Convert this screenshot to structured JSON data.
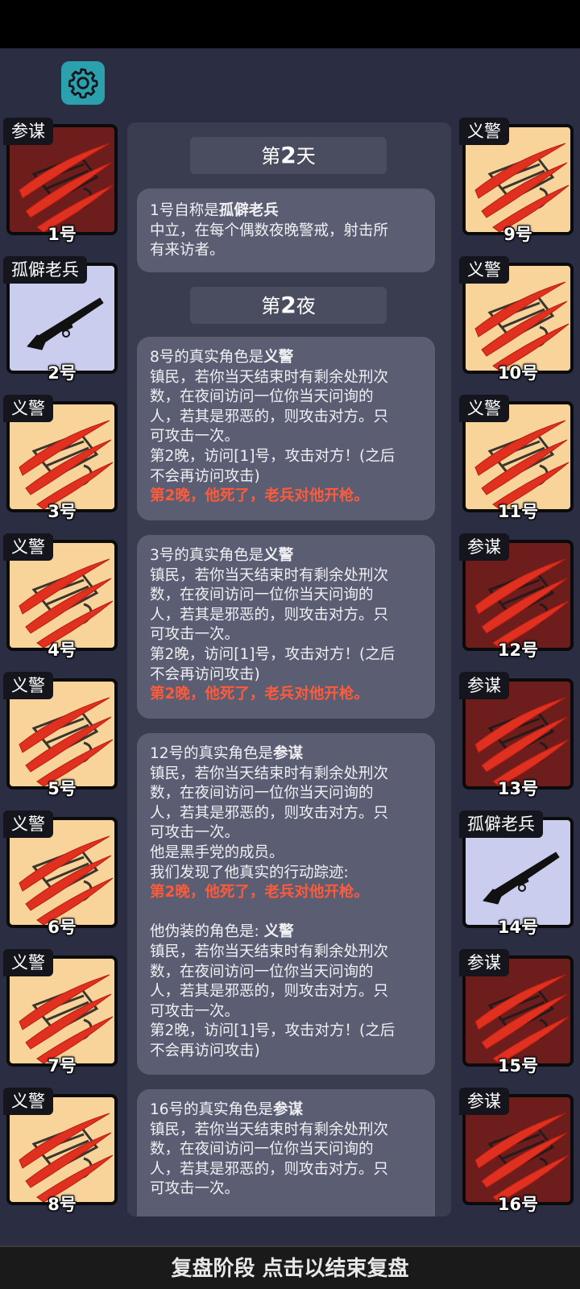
{
  "footer": {
    "label": "复盘阶段 点击以结束复盘"
  },
  "icons": {
    "settings": "gear-icon",
    "claw": "claw-mark-icon",
    "rifle": "rifle-icon"
  },
  "colors": {
    "yellow_card": "#f8d49b",
    "red_card": "#6e1d1d",
    "lavender_card": "#cbcdef",
    "accent": "#2aa1ad",
    "death_text": "#ff5a3a"
  },
  "left_players": [
    {
      "role": "参谋",
      "number": "1号",
      "style": "red",
      "art": "claw"
    },
    {
      "role": "孤僻老兵",
      "number": "2号",
      "style": "lav",
      "art": "rifle"
    },
    {
      "role": "义警",
      "number": "3号",
      "style": "yellow",
      "art": "claw"
    },
    {
      "role": "义警",
      "number": "4号",
      "style": "yellow",
      "art": "claw"
    },
    {
      "role": "义警",
      "number": "5号",
      "style": "yellow",
      "art": "claw"
    },
    {
      "role": "义警",
      "number": "6号",
      "style": "yellow",
      "art": "claw"
    },
    {
      "role": "义警",
      "number": "7号",
      "style": "yellow",
      "art": "claw"
    },
    {
      "role": "义警",
      "number": "8号",
      "style": "yellow",
      "art": "claw"
    }
  ],
  "right_players": [
    {
      "role": "义警",
      "number": "9号",
      "style": "yellow",
      "art": "claw"
    },
    {
      "role": "义警",
      "number": "10号",
      "style": "yellow",
      "art": "claw"
    },
    {
      "role": "义警",
      "number": "11号",
      "style": "yellow",
      "art": "claw"
    },
    {
      "role": "参谋",
      "number": "12号",
      "style": "red",
      "art": "claw"
    },
    {
      "role": "参谋",
      "number": "13号",
      "style": "red",
      "art": "claw"
    },
    {
      "role": "孤僻老兵",
      "number": "14号",
      "style": "lav",
      "art": "rifle"
    },
    {
      "role": "参谋",
      "number": "15号",
      "style": "red",
      "art": "claw"
    },
    {
      "role": "参谋",
      "number": "16号",
      "style": "red",
      "art": "claw"
    }
  ],
  "log": {
    "day_title": {
      "prefix": "第",
      "num": "2",
      "suffix": "天"
    },
    "night_title": {
      "prefix": "第",
      "num": "2",
      "suffix": "夜"
    },
    "day_entry": {
      "intro": "1号自称是",
      "role": "孤僻老兵",
      "lines": [
        "中立，在每个偶数夜晚警戒，射击所",
        "有来访者。"
      ]
    },
    "entries": [
      {
        "intro": "8号的真实角色是",
        "role": "义警",
        "lines": [
          "镇民，若你当天结束时有剩余处刑次",
          "数，在夜间访问一位你当天问询的",
          "人，若其是邪恶的，则攻击对方。只",
          "可攻击一次。",
          "第2晚，访问[1]号，攻击对方！(之后",
          "不会再访问攻击)"
        ],
        "death": "第2晚，他死了，老兵对他开枪。"
      },
      {
        "intro": "3号的真实角色是",
        "role": "义警",
        "lines": [
          "镇民，若你当天结束时有剩余处刑次",
          "数，在夜间访问一位你当天问询的",
          "人，若其是邪恶的，则攻击对方。只",
          "可攻击一次。",
          "第2晚，访问[1]号，攻击对方！(之后",
          "不会再访问攻击)"
        ],
        "death": "第2晚，他死了，老兵对他开枪。"
      },
      {
        "intro": "12号的真实角色是",
        "role": "参谋",
        "lines": [
          "镇民，若你当天结束时有剩余处刑次",
          "数，在夜间访问一位你当天问询的",
          "人，若其是邪恶的，则攻击对方。只",
          "可攻击一次。",
          "他是黑手党的成员。",
          "我们发现了他真实的行动踪迹:"
        ],
        "death": "第2晚，他死了，老兵对他开枪。",
        "disguise_intro": "他伪装的角色是: ",
        "disguise_role": "义警",
        "disguise_lines": [
          "镇民，若你当天结束时有剩余处刑次",
          "数，在夜间访问一位你当天问询的",
          "人，若其是邪恶的，则攻击对方。只",
          "可攻击一次。",
          "第2晚，访问[1]号，攻击对方！(之后",
          "不会再访问攻击)"
        ]
      },
      {
        "intro": "16号的真实角色是",
        "role": "参谋",
        "lines": [
          "镇民，若你当天结束时有剩余处刑次",
          "数，在夜间访问一位你当天问询的",
          "人，若其是邪恶的，则攻击对方。只",
          "可攻击一次。"
        ]
      }
    ]
  }
}
